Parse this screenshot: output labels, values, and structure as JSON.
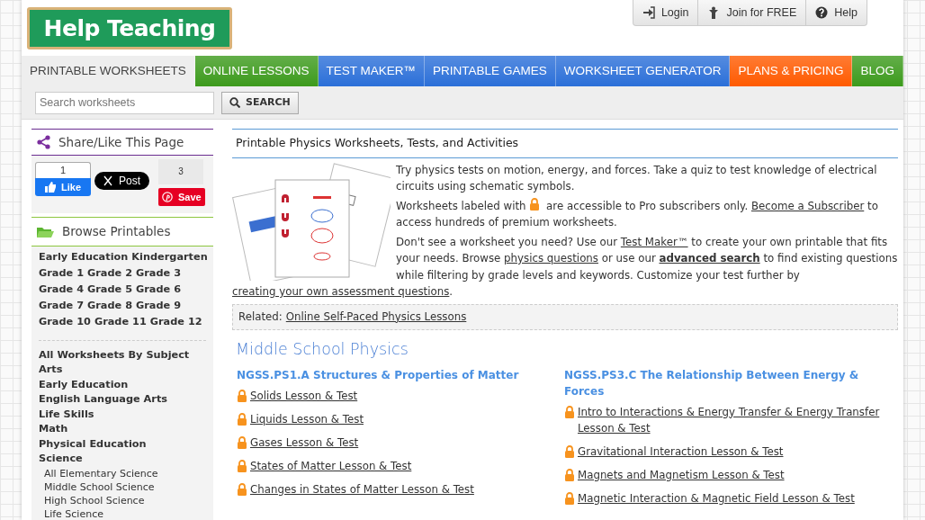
{
  "logo": {
    "text": "Help Teaching"
  },
  "account_links": [
    {
      "label": "Login",
      "kind": "login"
    },
    {
      "label": "Join for FREE",
      "kind": "join"
    },
    {
      "label": "Help",
      "kind": "help"
    }
  ],
  "nav_tabs": [
    {
      "label": "PRINTABLE WORKSHEETS",
      "color": "#eeeeee",
      "selected": true
    },
    {
      "label": "ONLINE LESSONS",
      "color": "#3c9a1c",
      "selected": false
    },
    {
      "label": "TEST MAKER™",
      "color": "#2b6fd8",
      "selected": false
    },
    {
      "label": "PRINTABLE GAMES",
      "color": "#2b6fd8",
      "selected": false
    },
    {
      "label": "WORKSHEET GENERATOR",
      "color": "#2b6fd8",
      "selected": false
    },
    {
      "label": "PLANS & PRICING",
      "color": "#ff5a00",
      "selected": false
    },
    {
      "label": "BLOG",
      "color": "#3c9a1c",
      "selected": false
    }
  ],
  "search": {
    "placeholder": "Search worksheets",
    "button": "SEARCH"
  },
  "share_panel": {
    "title": "Share/Like This Page",
    "like_count": "1",
    "like_label": "Like",
    "post_label": "Post",
    "save_count": "3",
    "save_label": "Save"
  },
  "browse_panel": {
    "title": "Browse Printables",
    "grade_rows": [
      [
        "Early Education",
        "Kindergarten"
      ],
      [
        "Grade 1",
        "Grade 2",
        "Grade 3"
      ],
      [
        "Grade 4",
        "Grade 5",
        "Grade 6"
      ],
      [
        "Grade 7",
        "Grade 8",
        "Grade 9"
      ],
      [
        "Grade 10",
        "Grade 11",
        "Grade 12"
      ]
    ],
    "subjects": [
      {
        "label": "All Worksheets By Subject",
        "kind": "subject"
      },
      {
        "label": "Arts",
        "kind": "subject"
      },
      {
        "label": "Early Education",
        "kind": "subject"
      },
      {
        "label": "English Language Arts",
        "kind": "subject"
      },
      {
        "label": "Life Skills",
        "kind": "subject"
      },
      {
        "label": "Math",
        "kind": "subject"
      },
      {
        "label": "Physical Education",
        "kind": "subject"
      },
      {
        "label": "Science",
        "kind": "subject"
      },
      {
        "label": "All Elementary Science",
        "kind": "sub"
      },
      {
        "label": "Middle School Science",
        "kind": "sub"
      },
      {
        "label": "High School Science",
        "kind": "sub"
      },
      {
        "label": "Life Science",
        "kind": "sub"
      }
    ]
  },
  "intro": {
    "title": "Printable Physics Worksheets, Tests, and Activities",
    "paragraphs": [
      [
        {
          "kind": "text",
          "text": "Try physics tests on motion, energy, and forces. Take a quiz to test knowledge of electrical circuits using schematic symbols."
        }
      ],
      [
        {
          "kind": "text",
          "text": "Worksheets labeled with "
        },
        {
          "kind": "lock"
        },
        {
          "kind": "text",
          "text": " are accessible to Pro subscribers only. "
        },
        {
          "kind": "link",
          "text": "Become a Subscriber"
        },
        {
          "kind": "text",
          "text": " to access hundreds of premium worksheets."
        }
      ],
      [
        {
          "kind": "text",
          "text": "Don't see a worksheet you need? Use our "
        },
        {
          "kind": "link",
          "text": "Test Maker™"
        },
        {
          "kind": "text",
          "text": " to create your own printable that fits your needs. Browse "
        },
        {
          "kind": "link",
          "text": "physics questions"
        },
        {
          "kind": "text",
          "text": " or use our "
        },
        {
          "kind": "bold_link",
          "text": "advanced search"
        },
        {
          "kind": "text",
          "text": " to find existing questions while filtering by grade levels and keywords. Customize your test further by "
        },
        {
          "kind": "link",
          "text": "creating your own assessment questions"
        },
        {
          "kind": "text",
          "text": "."
        }
      ]
    ],
    "related_label": "Related:",
    "related_link": "Online Self-Paced Physics Lessons"
  },
  "section": {
    "title": "Middle School Physics",
    "columns": [
      {
        "heading": "NGSS.PS1.A Structures & Properties of Matter",
        "items": [
          {
            "label": "Solids Lesson & Test",
            "locked": true
          },
          {
            "label": "Liquids Lesson & Test",
            "locked": true
          },
          {
            "label": "Gases Lesson & Test",
            "locked": true
          },
          {
            "label": "States of Matter Lesson & Test",
            "locked": true
          },
          {
            "label": "Changes in States of Matter Lesson & Test",
            "locked": true
          }
        ]
      },
      {
        "heading": "NGSS.PS3.C The Relationship Between Energy & Forces",
        "items": [
          {
            "label": "Intro to Interactions & Energy Transfer & Energy Transfer Lesson & Test",
            "locked": true
          },
          {
            "label": "Gravitational Interaction Lesson & Test",
            "locked": true
          },
          {
            "label": "Magnets and Magnetism Lesson & Test",
            "locked": true
          },
          {
            "label": "Magnetic Interaction & Magnetic Field Lesson & Test",
            "locked": true
          }
        ]
      }
    ]
  }
}
